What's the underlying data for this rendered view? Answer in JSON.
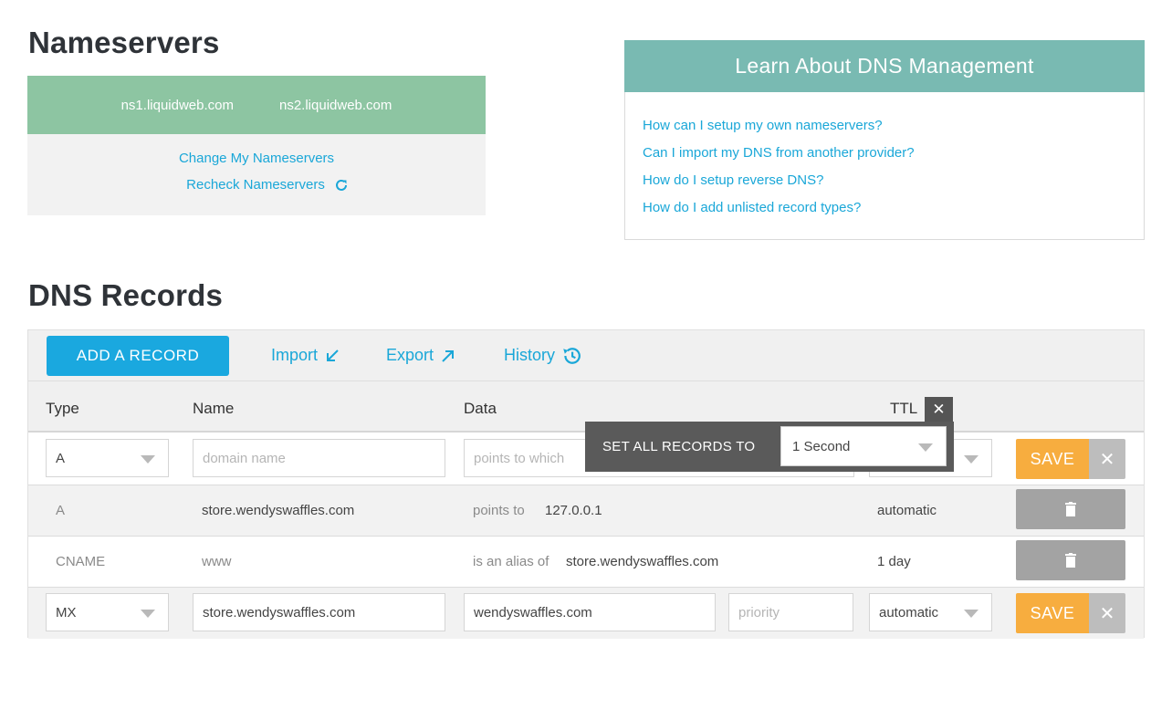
{
  "nameservers": {
    "title": "Nameservers",
    "servers": [
      "ns1.liquidweb.com",
      "ns2.liquidweb.com"
    ],
    "change_link": "Change My Nameservers",
    "recheck_link": "Recheck Nameservers"
  },
  "learn": {
    "title": "Learn About DNS Management",
    "links": [
      "How can I setup my own nameservers?",
      "Can I import my DNS from another provider?",
      "How do I setup reverse DNS?",
      "How do I add unlisted record types?"
    ]
  },
  "dns": {
    "title": "DNS Records",
    "toolbar": {
      "add_label": "ADD A RECORD",
      "import_label": "Import",
      "export_label": "Export",
      "history_label": "History"
    },
    "columns": {
      "type": "Type",
      "name": "Name",
      "data": "Data",
      "ttl": "TTL"
    },
    "new_row": {
      "type": "A",
      "name_placeholder": "domain name",
      "data_placeholder": "points to which",
      "save_label": "SAVE",
      "cancel_label": "✕"
    },
    "records": [
      {
        "type": "A",
        "name": "store.wendyswaffles.com",
        "data_prefix": "points to",
        "data_value": "127.0.0.1",
        "ttl": "automatic"
      },
      {
        "type": "CNAME",
        "name": "www",
        "data_prefix": "is an alias of",
        "data_value": "store.wendyswaffles.com",
        "ttl": "1 day"
      }
    ],
    "edit_row": {
      "type": "MX",
      "name": "store.wendyswaffles.com",
      "data": "wendyswaffles.com",
      "priority_placeholder": "priority",
      "ttl": "automatic",
      "save_label": "SAVE",
      "cancel_label": "✕"
    },
    "set_all": {
      "label": "SET ALL RECORDS TO",
      "value": "1 Second",
      "close_label": "✕"
    }
  }
}
